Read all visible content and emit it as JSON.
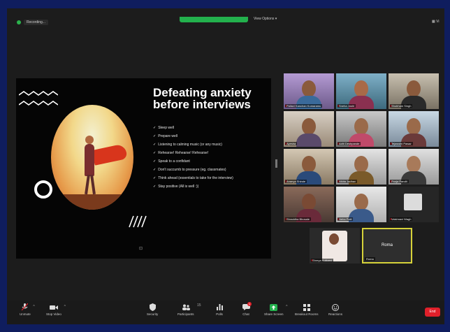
{
  "topbar": {
    "recording_label": "Recording...",
    "view_options_label": "View Options",
    "view_label": "Vi"
  },
  "slide": {
    "title_line1": "Defeating anxiety",
    "title_line2": "before interviews",
    "bullets": [
      "Sleep well",
      "Prepare well",
      "Listening to calming music (or any music)",
      "Rehearse! Rehearse! Rehearse!",
      "Speak to a confidant",
      "Don't succumb to pressure (eg. classmates)",
      "Think ahead (essentials to take for the interview)",
      "Stay positive (All is well :))"
    ]
  },
  "gallery": {
    "participants": [
      "Pallavi Kanchan Kumaramu",
      "Sneha Joshi",
      "Shubham Singh",
      "Ayesha",
      "Aditi Deshpande",
      "Tejaswini Pawar",
      "Ananya Shinde",
      "Nikita Jadhav",
      "Pooja Pandit",
      "Shraddha Bhosale",
      "Neha Patil",
      "Vaishnavi Wagh",
      "Shreya Kulkarni",
      "Roma"
    ],
    "active_speaker": "Roma"
  },
  "toolbar": {
    "unmute": "Unmute",
    "stop_video": "Stop Video",
    "security": "Security",
    "participants": "Participants",
    "participants_count": "15",
    "polls": "Polls",
    "chat": "Chat",
    "chat_badge": "1",
    "share_screen": "Share Screen",
    "breakout_rooms": "Breakout Rooms",
    "reactions": "Reactions",
    "end": "End"
  },
  "colors": {
    "background": "#0f1d5e",
    "window": "#1c1c1c",
    "share_green": "#23b14d",
    "active_speaker_border": "#d6d23a",
    "end_red": "#e0202a"
  }
}
